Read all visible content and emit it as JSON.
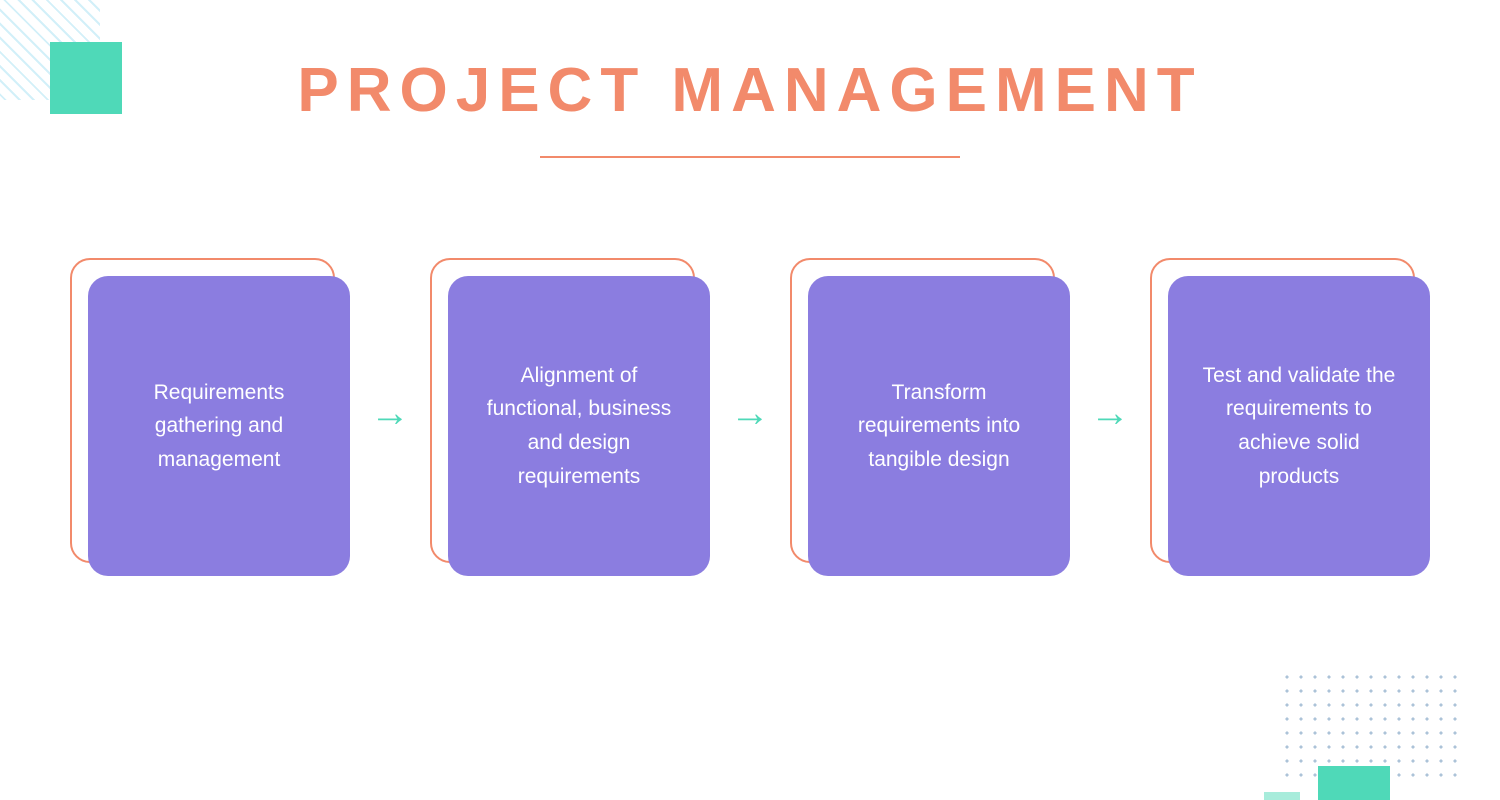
{
  "title": "PROJECT MANAGEMENT",
  "steps": [
    {
      "text": "Requirements gathering and management"
    },
    {
      "text": "Alignment of functional, business and design requirements"
    },
    {
      "text": "Transform requirements into tangible design"
    },
    {
      "text": "Test and validate the requirements to achieve solid products"
    }
  ],
  "colors": {
    "accent_coral": "#f28a6b",
    "box_purple": "#8b7de0",
    "arrow_teal": "#4fd9b8"
  }
}
